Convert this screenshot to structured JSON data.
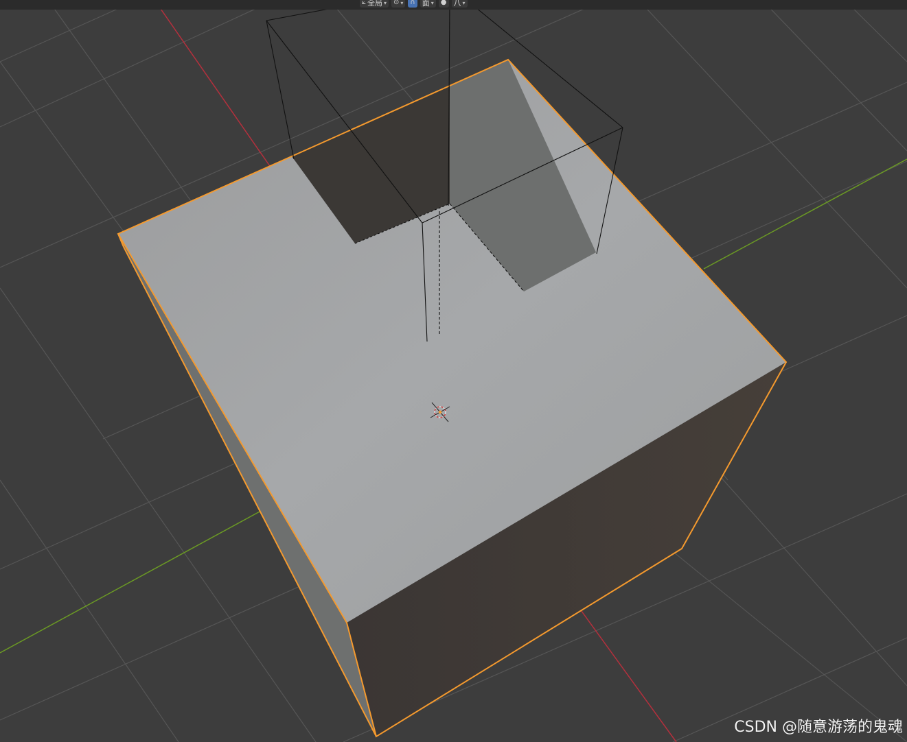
{
  "header": {
    "transform_orientation": {
      "label": "全局",
      "icon": "orientation-icon"
    },
    "pivot": {
      "icon": "pivot-point-icon"
    },
    "snapping": {
      "label": "面",
      "icon": "snap-magnet-icon"
    },
    "proportional": {
      "label": "八",
      "icon": "proportional-edit-icon"
    }
  },
  "viewport": {
    "axis_colors": {
      "x": "#b5303d",
      "y": "#6b9a24"
    },
    "grid_color": "#565656",
    "background": "#3d3d3d",
    "selection_outline": "#f59a2e",
    "object_icons": [
      "3d-cursor-icon"
    ]
  },
  "watermark": "CSDN @随意游荡的鬼魂"
}
